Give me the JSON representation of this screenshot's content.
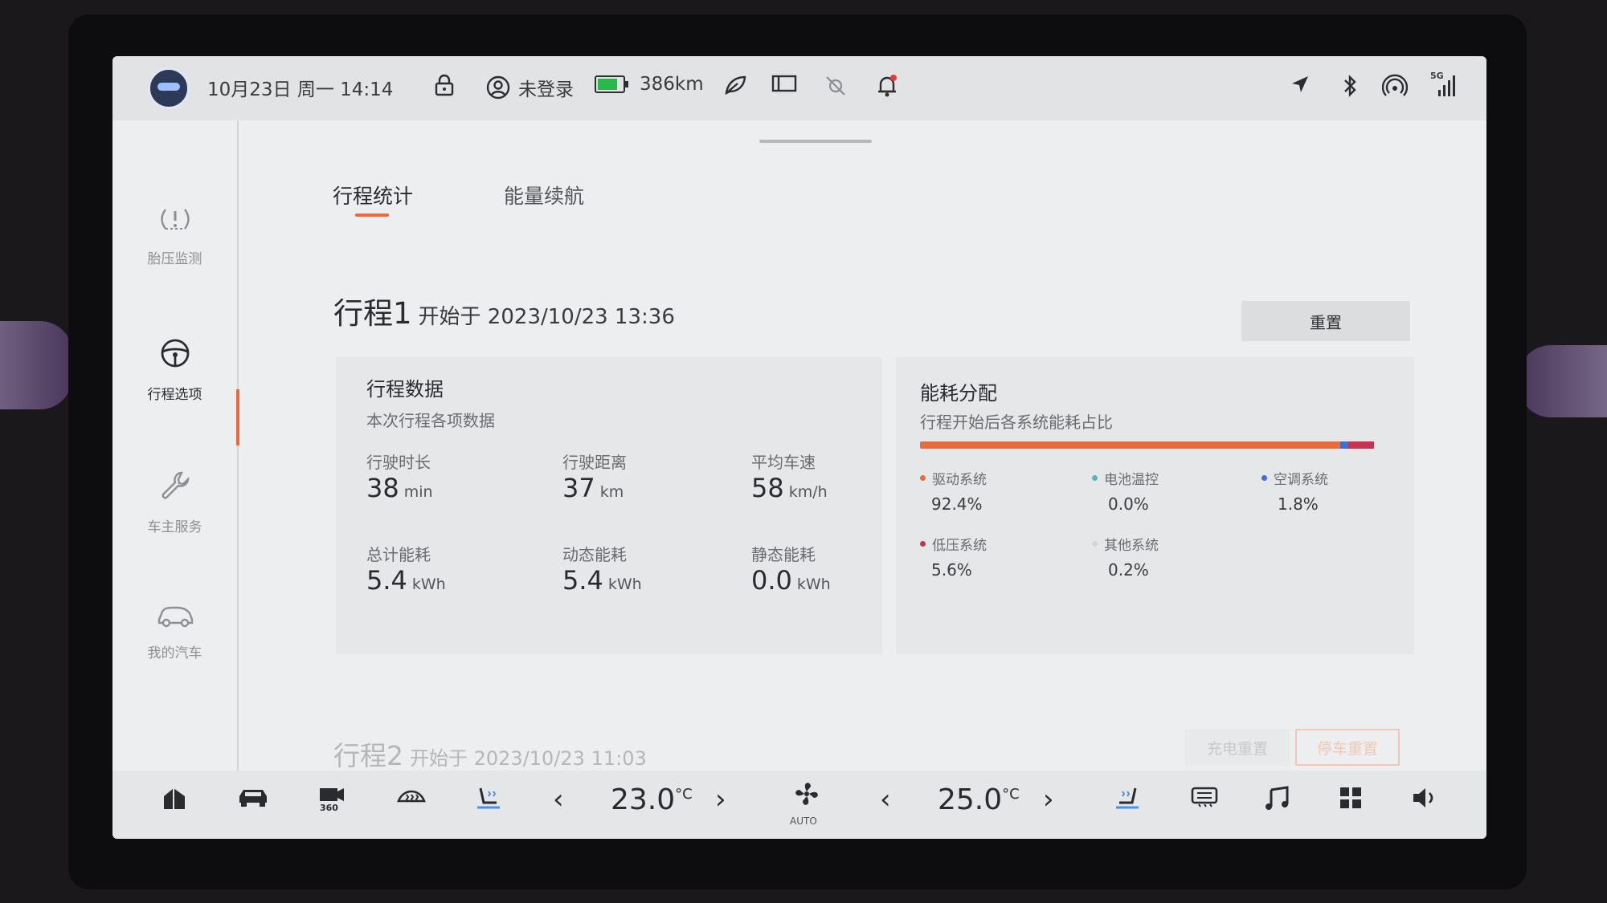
{
  "status": {
    "datetime": "10月23日 周一 14:14",
    "login": "未登录",
    "range": "386km",
    "network": "5G"
  },
  "sidebar": {
    "items": [
      {
        "label": "胎压监测",
        "icon": "tire-pressure-icon"
      },
      {
        "label": "行程选项",
        "icon": "steering-wheel-icon"
      },
      {
        "label": "车主服务",
        "icon": "wrench-icon"
      },
      {
        "label": "我的汽车",
        "icon": "car-icon"
      }
    ]
  },
  "tabs": [
    {
      "label": "行程统计"
    },
    {
      "label": "能量续航"
    }
  ],
  "trip1": {
    "title": "行程1",
    "start": "开始于 2023/10/23 13:36",
    "reset_label": "重置"
  },
  "trip_data": {
    "title": "行程数据",
    "subtitle": "本次行程各项数据",
    "metrics": [
      {
        "label": "行驶时长",
        "value": "38",
        "unit": "min"
      },
      {
        "label": "行驶距离",
        "value": "37",
        "unit": "km"
      },
      {
        "label": "平均车速",
        "value": "58",
        "unit": "km/h"
      },
      {
        "label": "总计能耗",
        "value": "5.4",
        "unit": "kWh"
      },
      {
        "label": "动态能耗",
        "value": "5.4",
        "unit": "kWh"
      },
      {
        "label": "静态能耗",
        "value": "0.0",
        "unit": "kWh"
      }
    ]
  },
  "energy": {
    "title": "能耗分配",
    "subtitle": "行程开始后各系统能耗占比",
    "segments": [
      {
        "name": "驱动系统",
        "value": "92.4%",
        "pct": 92.4,
        "color": "#e96b3d"
      },
      {
        "name": "电池温控",
        "value": "0.0%",
        "pct": 0.0,
        "color": "#4fb7c4"
      },
      {
        "name": "空调系统",
        "value": "1.8%",
        "pct": 1.8,
        "color": "#3d6fd6"
      },
      {
        "name": "低压系统",
        "value": "5.6%",
        "pct": 5.6,
        "color": "#c8324e"
      },
      {
        "name": "其他系统",
        "value": "0.2%",
        "pct": 0.2,
        "color": "#d6d6d6"
      }
    ]
  },
  "trip2": {
    "title": "行程2",
    "start": "开始于 2023/10/23 11:03",
    "charge_reset": "充电重置",
    "park_reset": "停车重置"
  },
  "dock": {
    "temp_left": "23.0",
    "temp_right": "25.0",
    "temp_unit": "°C",
    "fan_mode": "AUTO"
  }
}
